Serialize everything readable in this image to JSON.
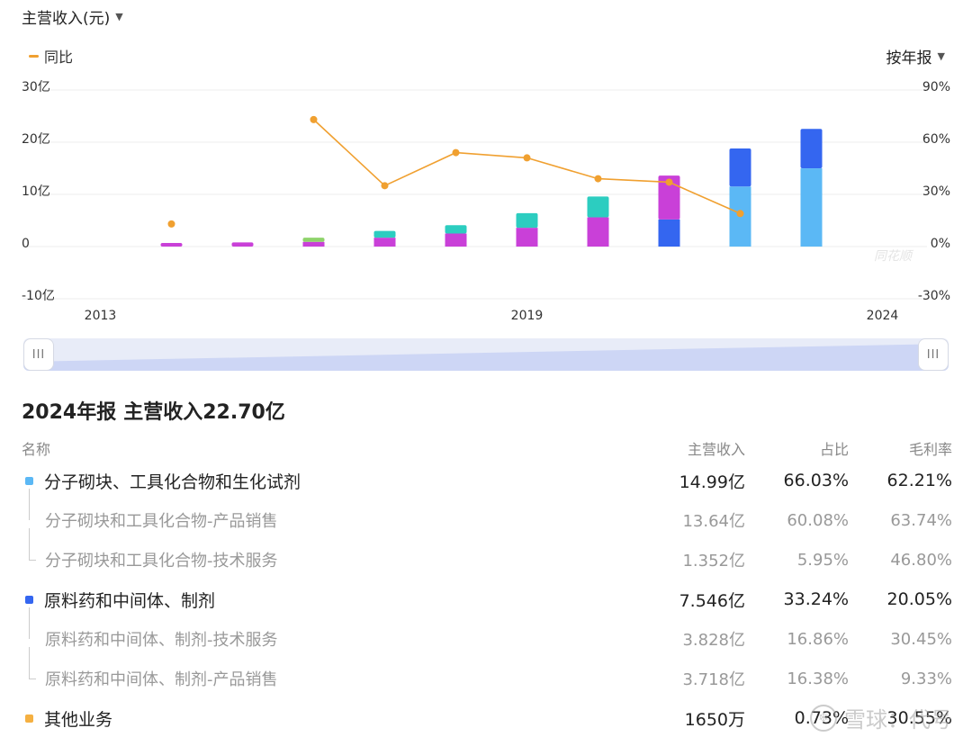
{
  "header": {
    "metric": "主营收入(元)",
    "legend_yoy": "同比",
    "period": "按年报"
  },
  "colors": {
    "yoy_line": "#f0a030",
    "segment_molecular": "#5bb8f5",
    "segment_api": "#3466f0",
    "segment_other": "#f5b041",
    "legacy_magenta": "#c940d8",
    "legacy_teal": "#2ccdc0",
    "legacy_green": "#8ed36a",
    "slider_fill": "#cdd6f5"
  },
  "chart_data": {
    "type": "bar",
    "stacked": true,
    "x": [
      "2013",
      "2014",
      "2015",
      "2016",
      "2017",
      "2018",
      "2019",
      "2020",
      "2021",
      "2022",
      "2023",
      "2024"
    ],
    "x_tick_labels": [
      "2013",
      "2019",
      "2024"
    ],
    "y_left": {
      "ylim": [
        -10,
        30
      ],
      "ticks": [
        "30亿",
        "20亿",
        "10亿",
        "0",
        "-10亿"
      ]
    },
    "y_right": {
      "ylim": [
        -30,
        90
      ],
      "ticks": [
        "90%",
        "60%",
        "30%",
        "0%",
        "-30%"
      ]
    },
    "grid": true,
    "stacks": [
      [],
      [
        {
          "color": "#c940d8",
          "value": 0.7
        }
      ],
      [
        {
          "color": "#c940d8",
          "value": 0.8
        }
      ],
      [
        {
          "color": "#c940d8",
          "value": 0.9
        },
        {
          "color": "#8ed36a",
          "value": 0.8
        }
      ],
      [
        {
          "color": "#c940d8",
          "value": 1.7
        },
        {
          "color": "#2ccdc0",
          "value": 1.3
        }
      ],
      [
        {
          "color": "#c940d8",
          "value": 2.5
        },
        {
          "color": "#2ccdc0",
          "value": 1.6
        }
      ],
      [
        {
          "color": "#c940d8",
          "value": 3.6
        },
        {
          "color": "#2ccdc0",
          "value": 2.8
        }
      ],
      [
        {
          "color": "#c940d8",
          "value": 5.6
        },
        {
          "color": "#2ccdc0",
          "value": 4.0
        }
      ],
      [
        {
          "color": "#3466f0",
          "value": 5.2
        },
        {
          "color": "#c940d8",
          "value": 8.4
        }
      ],
      [
        {
          "color": "#5bb8f5",
          "value": 11.5
        },
        {
          "color": "#3466f0",
          "value": 7.3
        }
      ],
      [
        {
          "color": "#5bb8f5",
          "value": 14.99
        },
        {
          "color": "#3466f0",
          "value": 7.546
        }
      ]
    ],
    "series": [
      {
        "name": "同比",
        "axis": "right",
        "values": [
          null,
          13,
          null,
          73,
          35,
          54,
          51,
          39,
          37,
          19,
          null,
          null
        ]
      }
    ]
  },
  "summary": {
    "title": "2024年报",
    "revenue": "主营收入22.70亿"
  },
  "table": {
    "headers": {
      "name": "名称",
      "revenue": "主营收入",
      "share": "占比",
      "margin": "毛利率"
    },
    "rows": [
      {
        "name": "分子砌块、工具化合物和生化试剂",
        "revenue": "14.99亿",
        "share": "66.03%",
        "margin": "62.21%",
        "level": "main",
        "color": "#5bb8f5"
      },
      {
        "name": "分子砌块和工具化合物-产品销售",
        "revenue": "13.64亿",
        "share": "60.08%",
        "margin": "63.74%",
        "level": "sub"
      },
      {
        "name": "分子砌块和工具化合物-技术服务",
        "revenue": "1.352亿",
        "share": "5.95%",
        "margin": "46.80%",
        "level": "sub"
      },
      {
        "name": "原料药和中间体、制剂",
        "revenue": "7.546亿",
        "share": "33.24%",
        "margin": "20.05%",
        "level": "main",
        "color": "#3466f0"
      },
      {
        "name": "原料药和中间体、制剂-技术服务",
        "revenue": "3.828亿",
        "share": "16.86%",
        "margin": "30.45%",
        "level": "sub"
      },
      {
        "name": "原料药和中间体、制剂-产品销售",
        "revenue": "3.718亿",
        "share": "16.38%",
        "margin": "9.33%",
        "level": "sub"
      },
      {
        "name": "其他业务",
        "revenue": "1650万",
        "share": "0.73%",
        "margin": "30.55%",
        "level": "main",
        "color": "#f5b041"
      }
    ]
  },
  "watermark": {
    "chart": "同花顺",
    "page": "雪球：代号"
  }
}
